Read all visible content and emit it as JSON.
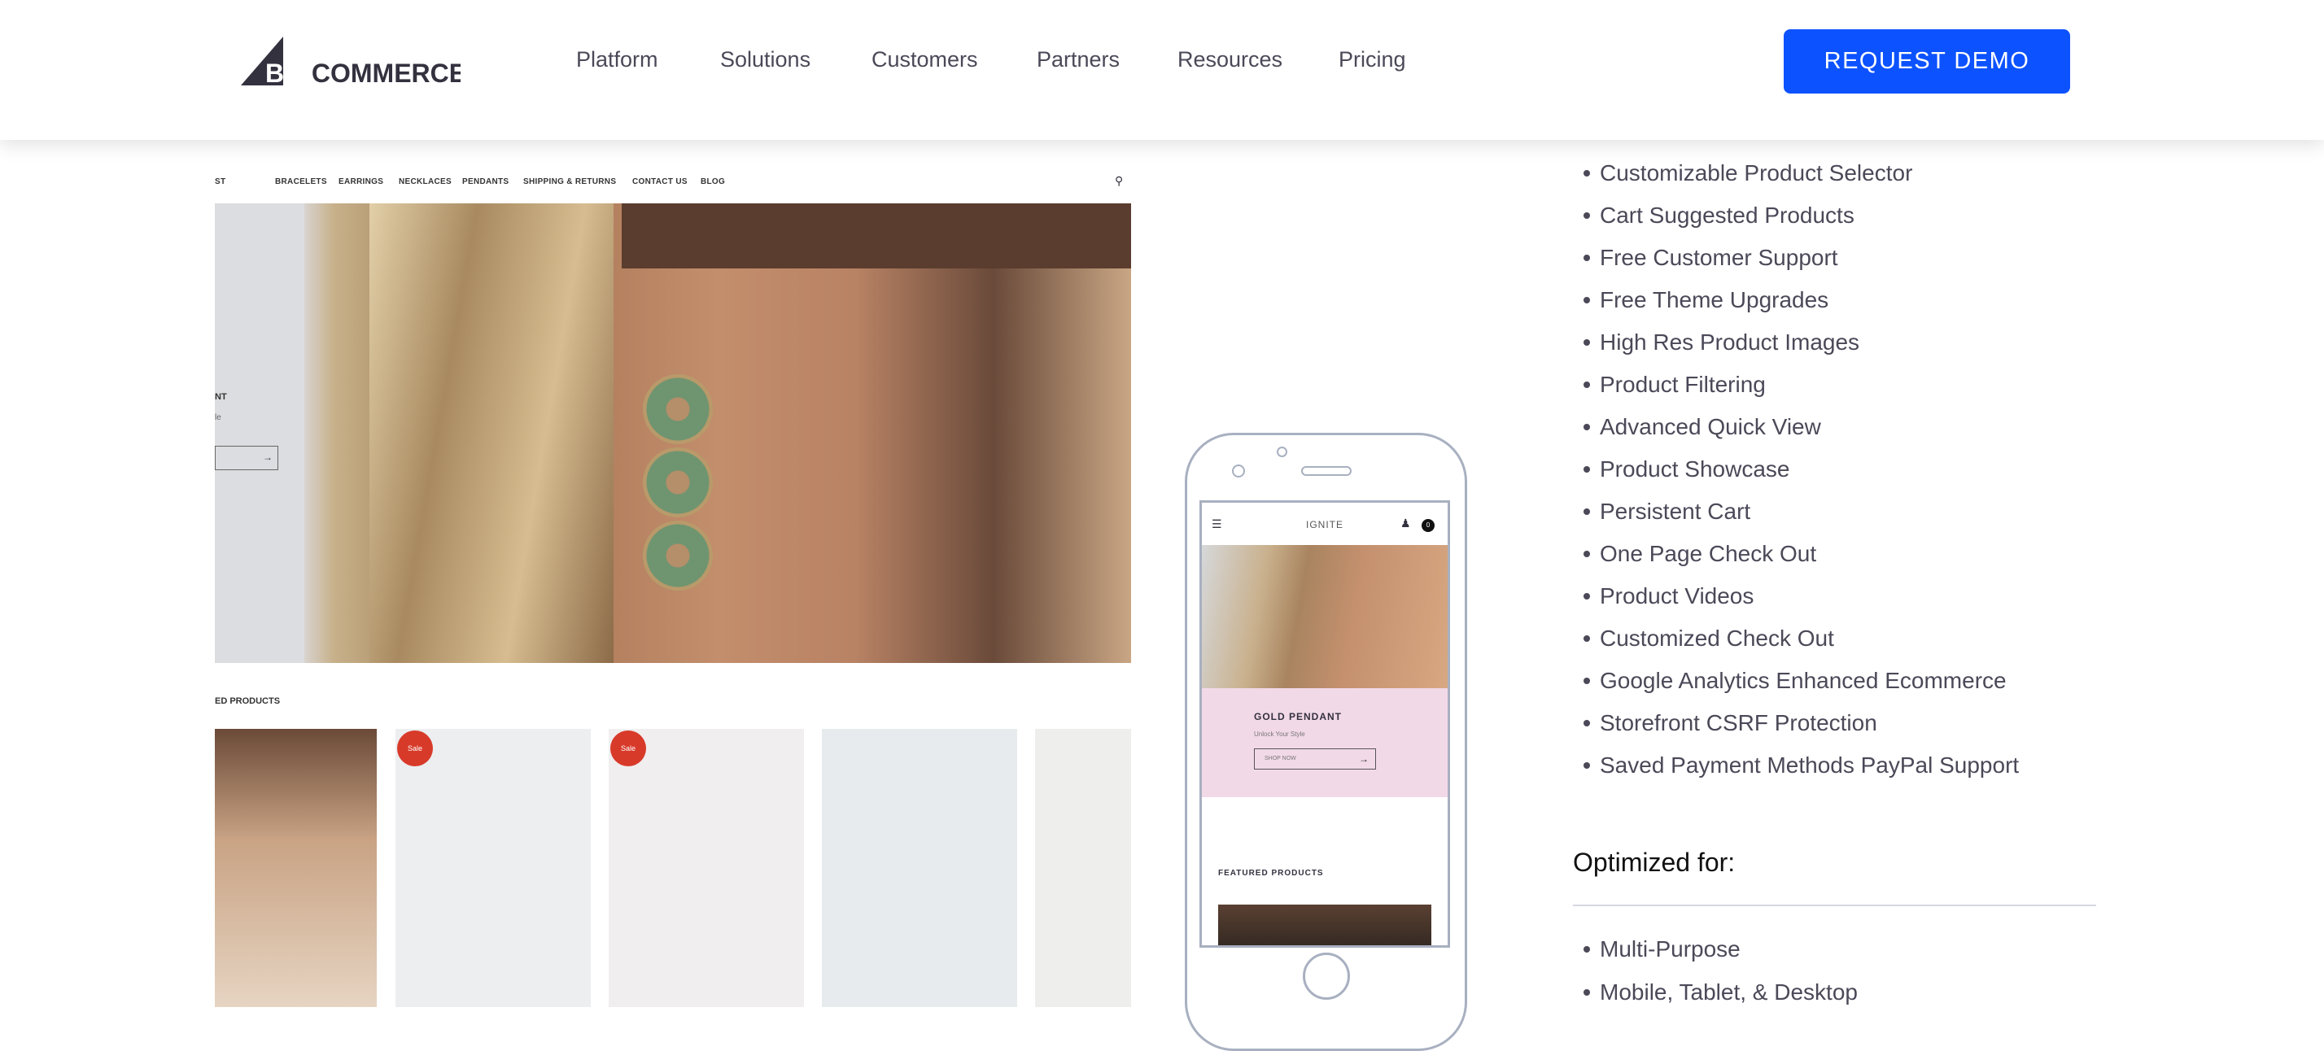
{
  "header": {
    "logo_text": "BIGCOMMERCE",
    "nav": [
      "Platform",
      "Solutions",
      "Customers",
      "Partners",
      "Resources",
      "Pricing"
    ],
    "cta": "REQUEST DEMO",
    "cta_color": "#0d52ff"
  },
  "desktop_mockup": {
    "nav": [
      "ST",
      "BRACELETS",
      "EARRINGS",
      "NECKLACES",
      "PENDANTS",
      "SHIPPING & RETURNS",
      "CONTACT US",
      "BLOG"
    ],
    "hero_title": "NT",
    "hero_sub": "le",
    "section": "ED PRODUCTS",
    "sale_badge": "Sale"
  },
  "mobile_mockup": {
    "brand": "IGNITE",
    "cart_count": "0",
    "hero_title": "GOLD PENDANT",
    "hero_sub": "Unlock Your Style",
    "hero_button": "SHOP NOW",
    "section": "FEATURED PRODUCTS"
  },
  "features": [
    "Customizable Product Selector",
    "Cart Suggested Products",
    "Free Customer Support",
    "Free Theme Upgrades",
    "High Res Product Images",
    "Product Filtering",
    "Advanced Quick View",
    "Product Showcase",
    "Persistent Cart",
    "One Page Check Out",
    "Product Videos",
    "Customized Check Out",
    "Google Analytics Enhanced Ecommerce",
    "Storefront CSRF Protection",
    "Saved Payment Methods PayPal Support"
  ],
  "optimized": {
    "title": "Optimized for:",
    "items": [
      "Multi-Purpose",
      "Mobile, Tablet, & Desktop"
    ]
  }
}
